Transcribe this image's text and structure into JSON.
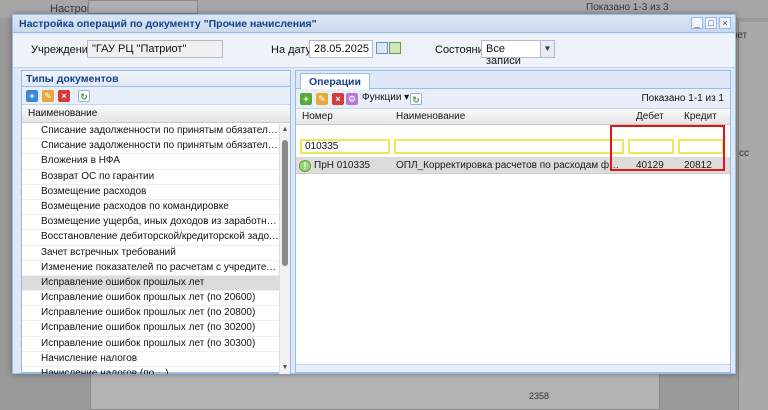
{
  "background": {
    "tab_label": "Настройки",
    "shown_text": "Показано 1-3 из 3",
    "right_text_1": "Счет",
    "right_text_2": "сс",
    "bottom_value": "2358"
  },
  "dialog": {
    "title": "Настройка операций по документу \"Прочие начисления\"",
    "controls": {
      "minimize": "_",
      "maximize": "□",
      "close": "×"
    }
  },
  "filters": {
    "institution_label": "Учреждение:",
    "institution_value": "\"ГАУ РЦ \"Патриот\"",
    "date_label": "На дату:",
    "date_value": "28.05.2025",
    "state_label": "Состояние:",
    "state_value": "Все записи"
  },
  "left_panel": {
    "title": "Типы документов",
    "column_header": "Наименование",
    "items": [
      "Списание задолженности по принятым обязательствам не вос...",
      "Списание задолженности по принятым обязательствам не вос...",
      "Вложения в НФА",
      "Возврат ОС по гарантии",
      "Возмещение расходов",
      "Возмещение расходов по командировке",
      "Возмещение ущерба, иных доходов из заработной платы",
      "Восстановление дебиторской/кредиторской задолженности",
      "Зачет встречных требований",
      "Изменение показателей по расчетам с учредителем",
      "Исправление ошибок прошлых лет",
      "Исправление ошибок прошлых лет (по 20600)",
      "Исправление ошибок прошлых лет (по 20800)",
      "Исправление ошибок прошлых лет (по 30200)",
      "Исправление ошибок прошлых лет (по 30300)",
      "Начисление налогов",
      "Начисление налогов (по ...)"
    ],
    "selected_index": 10
  },
  "right_panel": {
    "tab_label": "Операции",
    "functions_label": "Функции",
    "shown_text": "Показано 1-1 из 1",
    "columns": {
      "number": "Номер",
      "name": "Наименование",
      "debit": "Дебет",
      "credit": "Кредит"
    },
    "filter": {
      "number": "010335",
      "name": "",
      "debit": "",
      "credit": ""
    },
    "rows": [
      {
        "number": "ПрН 010335",
        "name": "ОПЛ_Корректировка расчетов по расходам финансового го...",
        "debit": "40129",
        "credit": "20812"
      }
    ]
  },
  "colors": {
    "highlight": "#e0141b",
    "filter_border": "#f0e65a",
    "header_text": "#15428b"
  }
}
